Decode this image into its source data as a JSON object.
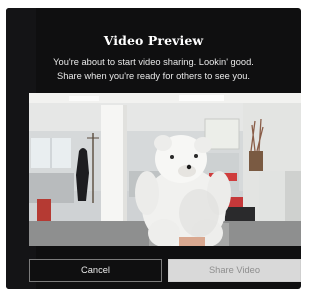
{
  "dialog": {
    "title": "Video Preview",
    "message_line1": "You're about to start video sharing. Lookin' good.",
    "message_line2": "Share when you're ready for others to see you."
  },
  "buttons": {
    "cancel_label": "Cancel",
    "share_label": "Share Video"
  },
  "colors": {
    "modal_bg": "#0f0f10",
    "share_disabled_bg": "#d9d9d9",
    "share_disabled_text": "#8e8e8e",
    "cancel_border": "#7c7c7c"
  }
}
